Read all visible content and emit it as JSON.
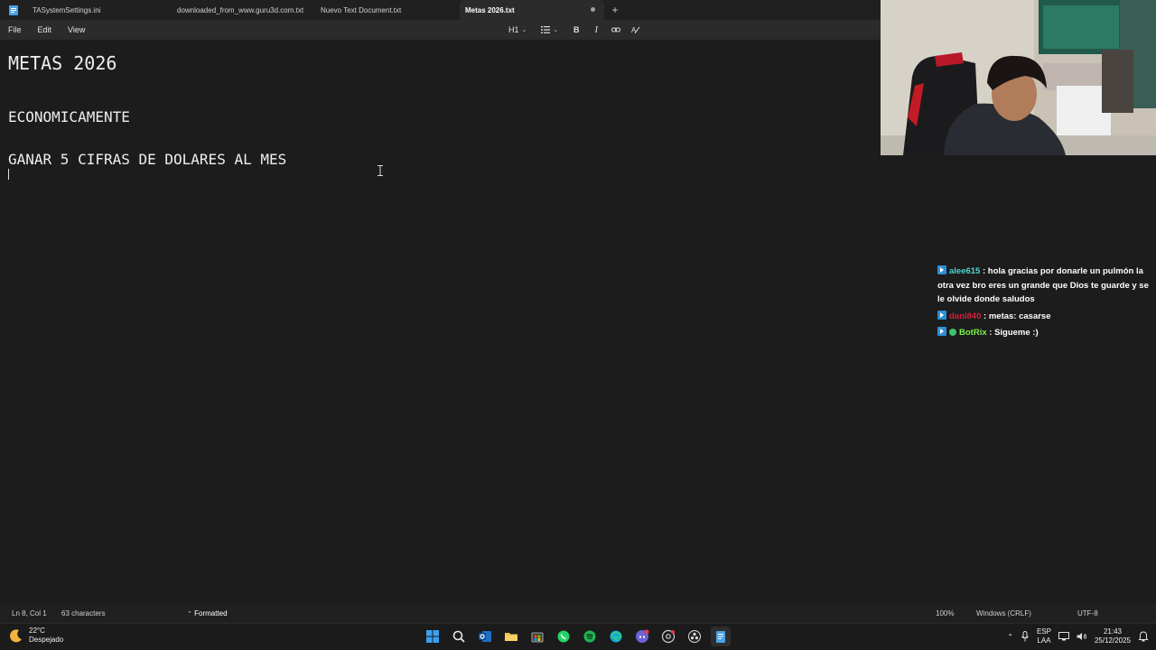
{
  "tabs": [
    {
      "label": "TASystemSettings.ini"
    },
    {
      "label": "downloaded_from_www.guru3d.com.txt"
    },
    {
      "label": "Nuevo Text Document.txt"
    },
    {
      "label": "Metas 2026.txt"
    }
  ],
  "menu": {
    "file": "File",
    "edit": "Edit",
    "view": "View"
  },
  "toolbar": {
    "heading": "H1"
  },
  "editor": {
    "lines": [
      "METAS 2026",
      "ECONOMICAMENTE",
      "GANAR 5 CIFRAS DE DOLARES AL MES"
    ]
  },
  "chat": {
    "messages": [
      {
        "user": "alee615",
        "text": ": hola gracias por donarle un pulmón la otra vez bro eres un grande que Dios te guarde y se le olvide donde saludos"
      },
      {
        "user": "dani840",
        "text": ": metas: casarse"
      },
      {
        "user": "BotRix",
        "text": ": Sigueme :)"
      }
    ]
  },
  "status": {
    "position": "Ln 8, Col 1",
    "chars": "63 characters",
    "format": "Formatted",
    "zoom": "100%",
    "eol": "Windows (CRLF)",
    "encoding": "UTF-8"
  },
  "taskbar": {
    "temp": "22°C",
    "weather": "Despejado",
    "lang1": "ESP",
    "lang2": "LAA",
    "time": "21:43",
    "date": "25/12/2025"
  }
}
